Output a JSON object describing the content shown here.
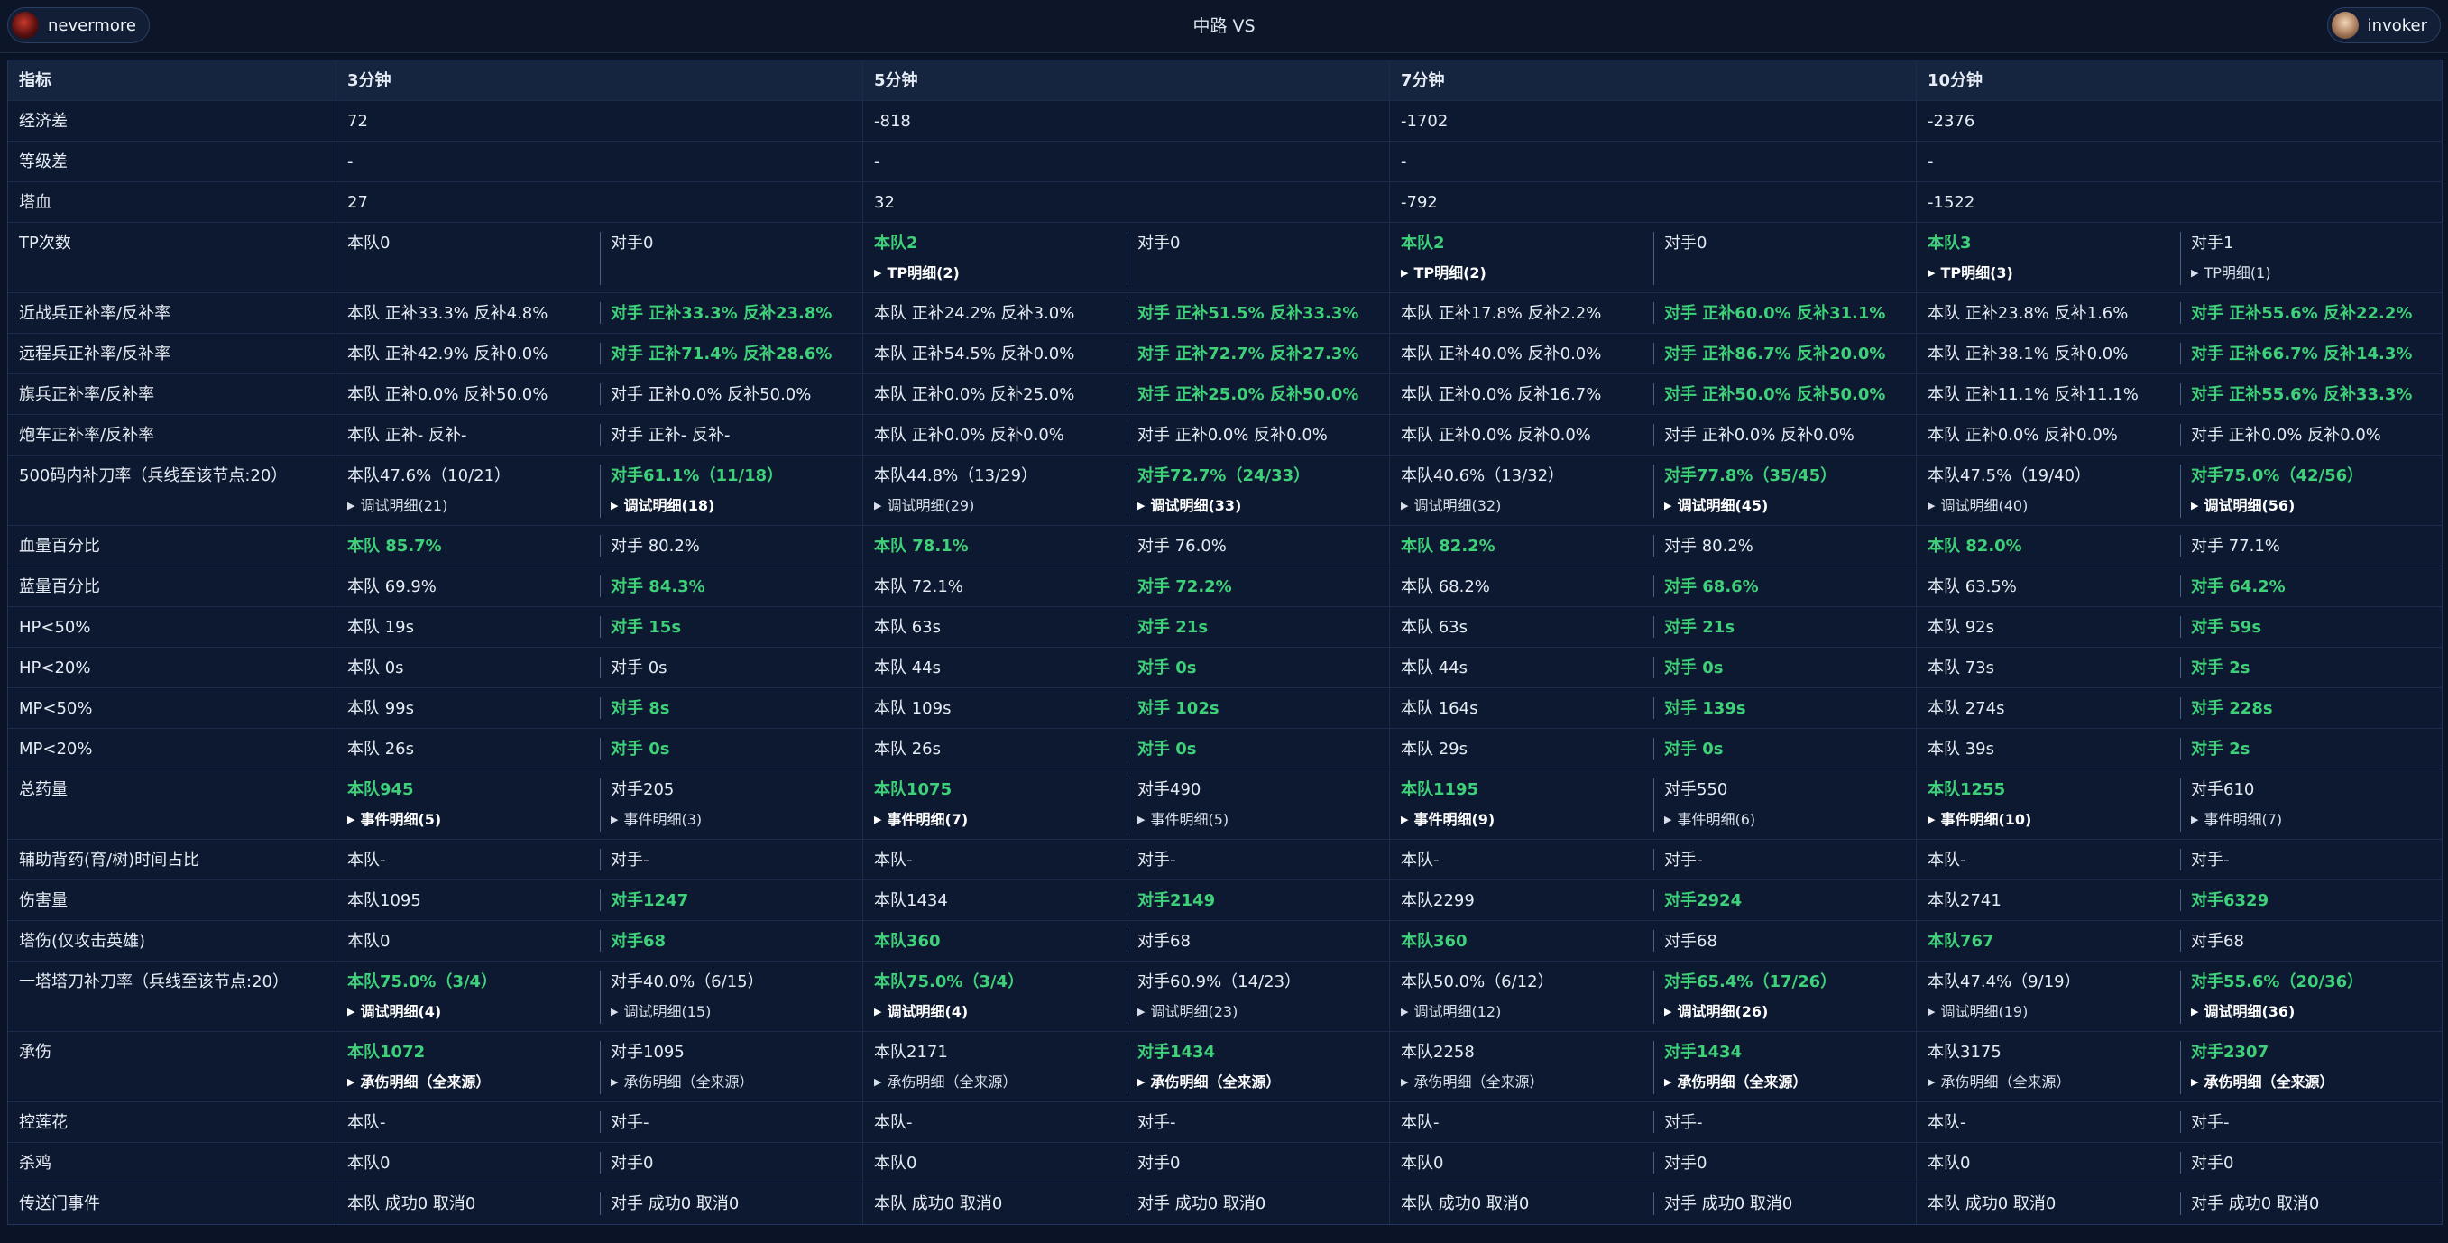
{
  "players": {
    "left": "nevermore",
    "right": "invoker"
  },
  "title": "中路 VS",
  "columns": [
    "指标",
    "3分钟",
    "5分钟",
    "7分钟",
    "10分钟"
  ],
  "rows": [
    {
      "label": "经济差",
      "type": "span",
      "vals": [
        "72",
        "-818",
        "-1702",
        "-2376"
      ]
    },
    {
      "label": "等级差",
      "type": "span",
      "vals": [
        "-",
        "-",
        "-",
        "-"
      ]
    },
    {
      "label": "塔血",
      "type": "span",
      "vals": [
        "27",
        "32",
        "-792",
        "-1522"
      ]
    },
    {
      "label": "TP次数",
      "type": "split",
      "tall": true,
      "cells": [
        {
          "t": "本队0",
          "g": false
        },
        {
          "t": "对手0",
          "g": false
        },
        {
          "t": "本队2",
          "g": true,
          "d": "TP明细(2)",
          "db": true
        },
        {
          "t": "对手0",
          "g": false
        },
        {
          "t": "本队2",
          "g": true,
          "d": "TP明细(2)",
          "db": true
        },
        {
          "t": "对手0",
          "g": false
        },
        {
          "t": "本队3",
          "g": true,
          "d": "TP明细(3)",
          "db": true
        },
        {
          "t": "对手1",
          "g": false,
          "d": "TP明细(1)",
          "db": false
        }
      ]
    },
    {
      "label": "近战兵正补率/反补率",
      "type": "split",
      "cells": [
        {
          "t": "本队 正补33.3% 反补4.8%",
          "g": false
        },
        {
          "t": "对手 正补33.3% 反补23.8%",
          "g": true
        },
        {
          "t": "本队 正补24.2% 反补3.0%",
          "g": false
        },
        {
          "t": "对手 正补51.5% 反补33.3%",
          "g": true
        },
        {
          "t": "本队 正补17.8% 反补2.2%",
          "g": false
        },
        {
          "t": "对手 正补60.0% 反补31.1%",
          "g": true
        },
        {
          "t": "本队 正补23.8% 反补1.6%",
          "g": false
        },
        {
          "t": "对手 正补55.6% 反补22.2%",
          "g": true
        }
      ]
    },
    {
      "label": "远程兵正补率/反补率",
      "type": "split",
      "cells": [
        {
          "t": "本队 正补42.9% 反补0.0%",
          "g": false
        },
        {
          "t": "对手 正补71.4% 反补28.6%",
          "g": true
        },
        {
          "t": "本队 正补54.5% 反补0.0%",
          "g": false
        },
        {
          "t": "对手 正补72.7% 反补27.3%",
          "g": true
        },
        {
          "t": "本队 正补40.0% 反补0.0%",
          "g": false
        },
        {
          "t": "对手 正补86.7% 反补20.0%",
          "g": true
        },
        {
          "t": "本队 正补38.1% 反补0.0%",
          "g": false
        },
        {
          "t": "对手 正补66.7% 反补14.3%",
          "g": true
        }
      ]
    },
    {
      "label": "旗兵正补率/反补率",
      "type": "split",
      "cells": [
        {
          "t": "本队 正补0.0% 反补50.0%",
          "g": false
        },
        {
          "t": "对手 正补0.0% 反补50.0%",
          "g": false
        },
        {
          "t": "本队 正补0.0% 反补25.0%",
          "g": false
        },
        {
          "t": "对手 正补25.0% 反补50.0%",
          "g": true
        },
        {
          "t": "本队 正补0.0% 反补16.7%",
          "g": false
        },
        {
          "t": "对手 正补50.0% 反补50.0%",
          "g": true
        },
        {
          "t": "本队 正补11.1% 反补11.1%",
          "g": false
        },
        {
          "t": "对手 正补55.6% 反补33.3%",
          "g": true
        }
      ]
    },
    {
      "label": "炮车正补率/反补率",
      "type": "split",
      "cells": [
        {
          "t": "本队 正补- 反补-",
          "g": false
        },
        {
          "t": "对手 正补- 反补-",
          "g": false
        },
        {
          "t": "本队 正补0.0% 反补0.0%",
          "g": false
        },
        {
          "t": "对手 正补0.0% 反补0.0%",
          "g": false
        },
        {
          "t": "本队 正补0.0% 反补0.0%",
          "g": false
        },
        {
          "t": "对手 正补0.0% 反补0.0%",
          "g": false
        },
        {
          "t": "本队 正补0.0% 反补0.0%",
          "g": false
        },
        {
          "t": "对手 正补0.0% 反补0.0%",
          "g": false
        }
      ]
    },
    {
      "label": "500码内补刀率（兵线至该节点:20）",
      "type": "split",
      "tall": true,
      "cells": [
        {
          "t": "本队47.6%（10/21）",
          "g": false,
          "d": "调试明细(21)",
          "db": false
        },
        {
          "t": "对手61.1%（11/18）",
          "g": true,
          "d": "调试明细(18)",
          "db": true
        },
        {
          "t": "本队44.8%（13/29）",
          "g": false,
          "d": "调试明细(29)",
          "db": false
        },
        {
          "t": "对手72.7%（24/33）",
          "g": true,
          "d": "调试明细(33)",
          "db": true
        },
        {
          "t": "本队40.6%（13/32）",
          "g": false,
          "d": "调试明细(32)",
          "db": false
        },
        {
          "t": "对手77.8%（35/45）",
          "g": true,
          "d": "调试明细(45)",
          "db": true
        },
        {
          "t": "本队47.5%（19/40）",
          "g": false,
          "d": "调试明细(40)",
          "db": false
        },
        {
          "t": "对手75.0%（42/56）",
          "g": true,
          "d": "调试明细(56)",
          "db": true
        }
      ]
    },
    {
      "label": "血量百分比",
      "type": "split",
      "cells": [
        {
          "t": "本队 85.7%",
          "g": true
        },
        {
          "t": "对手 80.2%",
          "g": false
        },
        {
          "t": "本队 78.1%",
          "g": true
        },
        {
          "t": "对手 76.0%",
          "g": false
        },
        {
          "t": "本队 82.2%",
          "g": true
        },
        {
          "t": "对手 80.2%",
          "g": false
        },
        {
          "t": "本队 82.0%",
          "g": true
        },
        {
          "t": "对手 77.1%",
          "g": false
        }
      ]
    },
    {
      "label": "蓝量百分比",
      "type": "split",
      "cells": [
        {
          "t": "本队 69.9%",
          "g": false
        },
        {
          "t": "对手 84.3%",
          "g": true
        },
        {
          "t": "本队 72.1%",
          "g": false
        },
        {
          "t": "对手 72.2%",
          "g": true
        },
        {
          "t": "本队 68.2%",
          "g": false
        },
        {
          "t": "对手 68.6%",
          "g": true
        },
        {
          "t": "本队 63.5%",
          "g": false
        },
        {
          "t": "对手 64.2%",
          "g": true
        }
      ]
    },
    {
      "label": "HP<50%",
      "type": "split",
      "cells": [
        {
          "t": "本队 19s",
          "g": false
        },
        {
          "t": "对手 15s",
          "g": true
        },
        {
          "t": "本队 63s",
          "g": false
        },
        {
          "t": "对手 21s",
          "g": true
        },
        {
          "t": "本队 63s",
          "g": false
        },
        {
          "t": "对手 21s",
          "g": true
        },
        {
          "t": "本队 92s",
          "g": false
        },
        {
          "t": "对手 59s",
          "g": true
        }
      ]
    },
    {
      "label": "HP<20%",
      "type": "split",
      "cells": [
        {
          "t": "本队 0s",
          "g": false
        },
        {
          "t": "对手 0s",
          "g": false
        },
        {
          "t": "本队 44s",
          "g": false
        },
        {
          "t": "对手 0s",
          "g": true
        },
        {
          "t": "本队 44s",
          "g": false
        },
        {
          "t": "对手 0s",
          "g": true
        },
        {
          "t": "本队 73s",
          "g": false
        },
        {
          "t": "对手 2s",
          "g": true
        }
      ]
    },
    {
      "label": "MP<50%",
      "type": "split",
      "cells": [
        {
          "t": "本队 99s",
          "g": false
        },
        {
          "t": "对手 8s",
          "g": true
        },
        {
          "t": "本队 109s",
          "g": false
        },
        {
          "t": "对手 102s",
          "g": true
        },
        {
          "t": "本队 164s",
          "g": false
        },
        {
          "t": "对手 139s",
          "g": true
        },
        {
          "t": "本队 274s",
          "g": false
        },
        {
          "t": "对手 228s",
          "g": true
        }
      ]
    },
    {
      "label": "MP<20%",
      "type": "split",
      "cells": [
        {
          "t": "本队 26s",
          "g": false
        },
        {
          "t": "对手 0s",
          "g": true
        },
        {
          "t": "本队 26s",
          "g": false
        },
        {
          "t": "对手 0s",
          "g": true
        },
        {
          "t": "本队 29s",
          "g": false
        },
        {
          "t": "对手 0s",
          "g": true
        },
        {
          "t": "本队 39s",
          "g": false
        },
        {
          "t": "对手 2s",
          "g": true
        }
      ]
    },
    {
      "label": "总药量",
      "type": "split",
      "tall": true,
      "cells": [
        {
          "t": "本队945",
          "g": true,
          "d": "事件明细(5)",
          "db": true
        },
        {
          "t": "对手205",
          "g": false,
          "d": "事件明细(3)",
          "db": false
        },
        {
          "t": "本队1075",
          "g": true,
          "d": "事件明细(7)",
          "db": true
        },
        {
          "t": "对手490",
          "g": false,
          "d": "事件明细(5)",
          "db": false
        },
        {
          "t": "本队1195",
          "g": true,
          "d": "事件明细(9)",
          "db": true
        },
        {
          "t": "对手550",
          "g": false,
          "d": "事件明细(6)",
          "db": false
        },
        {
          "t": "本队1255",
          "g": true,
          "d": "事件明细(10)",
          "db": true
        },
        {
          "t": "对手610",
          "g": false,
          "d": "事件明细(7)",
          "db": false
        }
      ]
    },
    {
      "label": "辅助背药(育/树)时间占比",
      "type": "split",
      "cells": [
        {
          "t": "本队-",
          "g": false
        },
        {
          "t": "对手-",
          "g": false
        },
        {
          "t": "本队-",
          "g": false
        },
        {
          "t": "对手-",
          "g": false
        },
        {
          "t": "本队-",
          "g": false
        },
        {
          "t": "对手-",
          "g": false
        },
        {
          "t": "本队-",
          "g": false
        },
        {
          "t": "对手-",
          "g": false
        }
      ]
    },
    {
      "label": "伤害量",
      "type": "split",
      "cells": [
        {
          "t": "本队1095",
          "g": false
        },
        {
          "t": "对手1247",
          "g": true
        },
        {
          "t": "本队1434",
          "g": false
        },
        {
          "t": "对手2149",
          "g": true
        },
        {
          "t": "本队2299",
          "g": false
        },
        {
          "t": "对手2924",
          "g": true
        },
        {
          "t": "本队2741",
          "g": false
        },
        {
          "t": "对手6329",
          "g": true
        }
      ]
    },
    {
      "label": "塔伤(仅攻击英雄)",
      "type": "split",
      "cells": [
        {
          "t": "本队0",
          "g": false
        },
        {
          "t": "对手68",
          "g": true
        },
        {
          "t": "本队360",
          "g": true
        },
        {
          "t": "对手68",
          "g": false
        },
        {
          "t": "本队360",
          "g": true
        },
        {
          "t": "对手68",
          "g": false
        },
        {
          "t": "本队767",
          "g": true
        },
        {
          "t": "对手68",
          "g": false
        }
      ]
    },
    {
      "label": "一塔塔刀补刀率（兵线至该节点:20）",
      "type": "split",
      "tall": true,
      "cells": [
        {
          "t": "本队75.0%（3/4）",
          "g": true,
          "d": "调试明细(4)",
          "db": true
        },
        {
          "t": "对手40.0%（6/15）",
          "g": false,
          "d": "调试明细(15)",
          "db": false
        },
        {
          "t": "本队75.0%（3/4）",
          "g": true,
          "d": "调试明细(4)",
          "db": true
        },
        {
          "t": "对手60.9%（14/23）",
          "g": false,
          "d": "调试明细(23)",
          "db": false
        },
        {
          "t": "本队50.0%（6/12）",
          "g": false,
          "d": "调试明细(12)",
          "db": false
        },
        {
          "t": "对手65.4%（17/26）",
          "g": true,
          "d": "调试明细(26)",
          "db": true
        },
        {
          "t": "本队47.4%（9/19）",
          "g": false,
          "d": "调试明细(19)",
          "db": false
        },
        {
          "t": "对手55.6%（20/36）",
          "g": true,
          "d": "调试明细(36)",
          "db": true
        }
      ]
    },
    {
      "label": "承伤",
      "type": "split",
      "tall": true,
      "cells": [
        {
          "t": "本队1072",
          "g": true,
          "d": "承伤明细（全来源）",
          "db": true
        },
        {
          "t": "对手1095",
          "g": false,
          "d": "承伤明细（全来源）",
          "db": false
        },
        {
          "t": "本队2171",
          "g": false,
          "d": "承伤明细（全来源）",
          "db": false
        },
        {
          "t": "对手1434",
          "g": true,
          "d": "承伤明细（全来源）",
          "db": true
        },
        {
          "t": "本队2258",
          "g": false,
          "d": "承伤明细（全来源）",
          "db": false
        },
        {
          "t": "对手1434",
          "g": true,
          "d": "承伤明细（全来源）",
          "db": true
        },
        {
          "t": "本队3175",
          "g": false,
          "d": "承伤明细（全来源）",
          "db": false
        },
        {
          "t": "对手2307",
          "g": true,
          "d": "承伤明细（全来源）",
          "db": true
        }
      ]
    },
    {
      "label": "控莲花",
      "type": "split",
      "cells": [
        {
          "t": "本队-",
          "g": false
        },
        {
          "t": "对手-",
          "g": false
        },
        {
          "t": "本队-",
          "g": false
        },
        {
          "t": "对手-",
          "g": false
        },
        {
          "t": "本队-",
          "g": false
        },
        {
          "t": "对手-",
          "g": false
        },
        {
          "t": "本队-",
          "g": false
        },
        {
          "t": "对手-",
          "g": false
        }
      ]
    },
    {
      "label": "杀鸡",
      "type": "split",
      "cells": [
        {
          "t": "本队0",
          "g": false
        },
        {
          "t": "对手0",
          "g": false
        },
        {
          "t": "本队0",
          "g": false
        },
        {
          "t": "对手0",
          "g": false
        },
        {
          "t": "本队0",
          "g": false
        },
        {
          "t": "对手0",
          "g": false
        },
        {
          "t": "本队0",
          "g": false
        },
        {
          "t": "对手0",
          "g": false
        }
      ]
    },
    {
      "label": "传送门事件",
      "type": "split",
      "cells": [
        {
          "t": "本队 成功0 取消0",
          "g": false
        },
        {
          "t": "对手 成功0 取消0",
          "g": false
        },
        {
          "t": "本队 成功0 取消0",
          "g": false
        },
        {
          "t": "对手 成功0 取消0",
          "g": false
        },
        {
          "t": "本队 成功0 取消0",
          "g": false
        },
        {
          "t": "对手 成功0 取消0",
          "g": false
        },
        {
          "t": "本队 成功0 取消0",
          "g": false
        },
        {
          "t": "对手 成功0 取消0",
          "g": false
        }
      ]
    }
  ]
}
